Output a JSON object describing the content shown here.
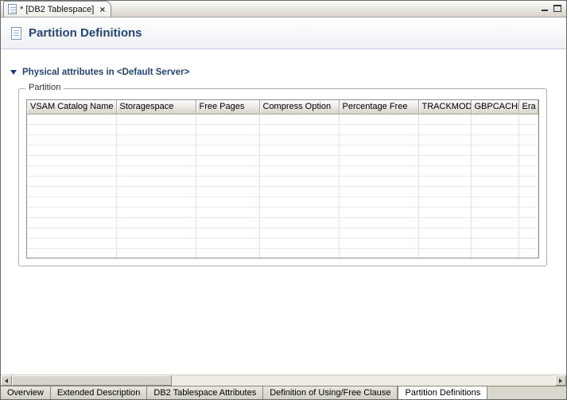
{
  "editor": {
    "tab_title": "* [DB2 Tablespace]"
  },
  "icons": {
    "close": "×"
  },
  "header": {
    "title": "Partition Definitions"
  },
  "section": {
    "title": "Physical attributes in <Default Server>"
  },
  "group": {
    "label": "Partition"
  },
  "table": {
    "columns": [
      "VSAM Catalog Name",
      "Storagespace",
      "Free Pages",
      "Compress Option",
      "Percentage Free",
      "TRACKMOD",
      "GBPCACHE",
      "Era"
    ],
    "row_count": 14
  },
  "bottom_tabs": [
    {
      "label": "Overview",
      "active": false
    },
    {
      "label": "Extended Description",
      "active": false
    },
    {
      "label": "DB2 Tablespace Attributes",
      "active": false
    },
    {
      "label": "Definition of Using/Free Clause",
      "active": false
    },
    {
      "label": "Partition Definitions",
      "active": true
    }
  ],
  "colors": {
    "heading": "#26466f",
    "tab_background": "#d7d3ca"
  }
}
